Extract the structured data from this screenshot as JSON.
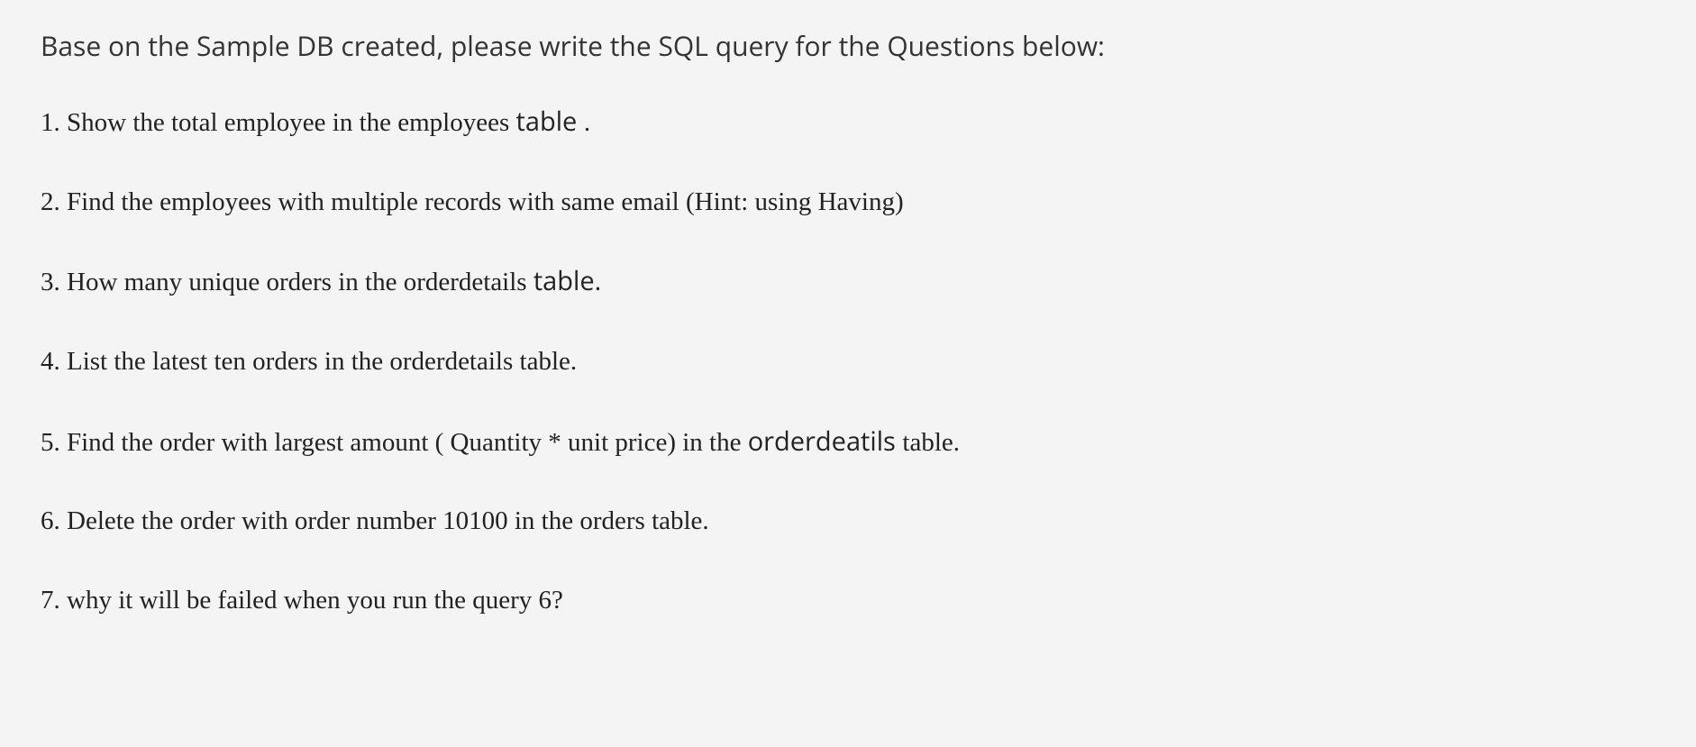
{
  "intro": "Base on the Sample DB created, please write the SQL query for the Questions below:",
  "questions": {
    "q1_prefix": "1. Show the total employee in the  employees ",
    "q1_sans": "table ",
    "q1_suffix": ".",
    "q2": "2. Find the employees with multiple records with same email (Hint: using Having)",
    "q3_prefix": "3. How many unique orders in the orderdetails  ",
    "q3_sans": "table.",
    "q4": "4. List the latest ten orders in the orderdetails table.",
    "q5_prefix": "5. Find the order with largest amount ( Quantity * unit price) in the ",
    "q5_sans": "orderdeatils ",
    "q5_suffix": "table.",
    "q6": "6. Delete the order with order number 10100 in the orders table.",
    "q7": "7. why it will be failed when you run the query 6?"
  }
}
